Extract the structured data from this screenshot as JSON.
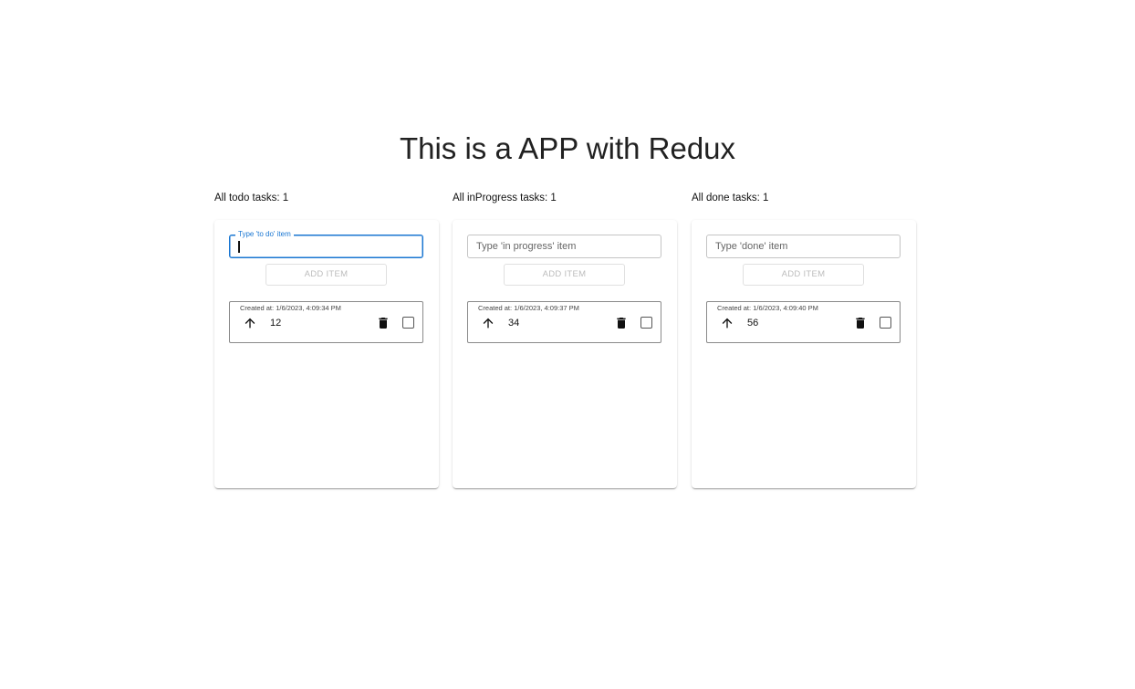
{
  "title": "This is a APP with Redux",
  "columns": [
    {
      "header": "All todo tasks: 1",
      "input": {
        "placeholder": "Type 'to do' item",
        "label": "Type 'to do' item",
        "value": ""
      },
      "add_label": "Add item",
      "tasks": [
        {
          "created": "Created at: 1/6/2023, 4:09:34 PM",
          "text": "12"
        }
      ]
    },
    {
      "header": "All inProgress tasks: 1",
      "input": {
        "placeholder": "Type 'in progress' item",
        "value": ""
      },
      "add_label": "Add item",
      "tasks": [
        {
          "created": "Created at: 1/6/2023, 4:09:37 PM",
          "text": "34"
        }
      ]
    },
    {
      "header": "All done tasks: 1",
      "input": {
        "placeholder": "Type 'done' item",
        "value": ""
      },
      "add_label": "Add item",
      "tasks": [
        {
          "created": "Created at: 1/6/2023, 4:09:40 PM",
          "text": "56"
        }
      ]
    }
  ],
  "icons": {
    "move": "arrow-upward-icon",
    "delete": "trash-icon",
    "complete": "checkbox-icon"
  },
  "colors": {
    "accent": "#1976d2",
    "text": "#212121",
    "disabled": "#bdbdbd"
  }
}
